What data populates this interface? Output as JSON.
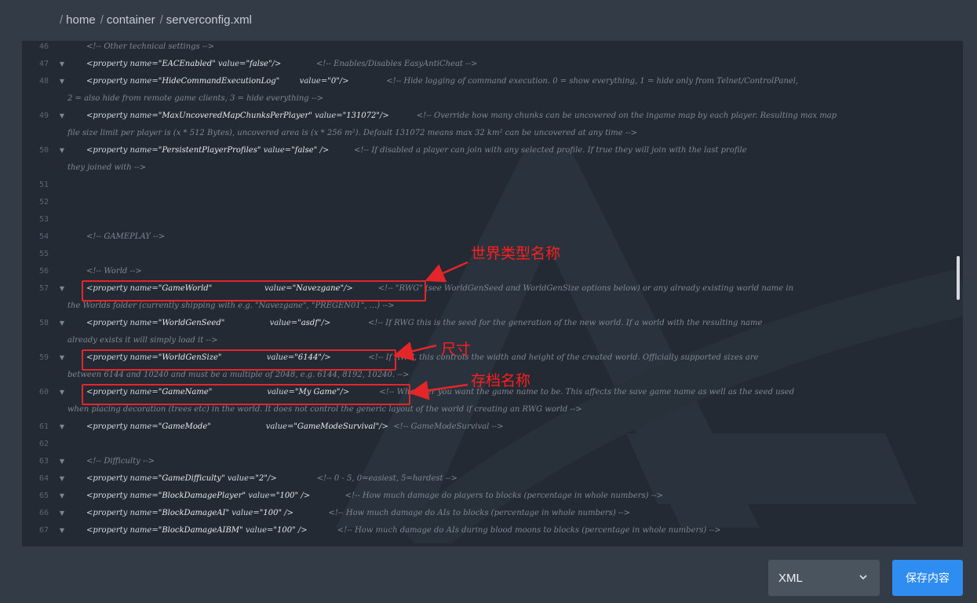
{
  "breadcrumb": {
    "items": [
      {
        "label": "home"
      },
      {
        "label": "container"
      },
      {
        "label": "serverconfig.xml"
      }
    ]
  },
  "editor": {
    "lines": [
      {
        "num": "46",
        "fold": false,
        "tokens": [
          [
            "tok-comment",
            "<!-- Other technical settings -->"
          ]
        ]
      },
      {
        "num": "47",
        "fold": true,
        "tokens": [
          [
            "tag",
            "<property "
          ],
          [
            "tok-attr",
            "name="
          ],
          [
            "tok-str",
            "\"EACEnabled\" "
          ],
          [
            "tok-attr",
            "value="
          ],
          [
            "tok-str",
            "\"false\""
          ],
          [
            "tag",
            "/>"
          ],
          [
            "tok-comment",
            "              <!-- Enables/Disables EasyAntiCheat -->"
          ]
        ]
      },
      {
        "num": "48",
        "fold": true,
        "tokens": [
          [
            "tag",
            "<property "
          ],
          [
            "tok-attr",
            "name="
          ],
          [
            "tok-str",
            "\"HideCommandExecutionLog\"        "
          ],
          [
            "tok-attr",
            "value="
          ],
          [
            "tok-str",
            "\"0\""
          ],
          [
            "tag",
            "/>"
          ],
          [
            "tok-comment",
            "               <!-- Hide logging of command execution. 0 = show everything, 1 = hide only from Telnet/ControlPanel,"
          ]
        ]
      },
      {
        "num": "",
        "fold": false,
        "cont": true,
        "tokens": [
          [
            "tok-comment",
            "2 = also hide from remote game clients, 3 = hide everything -->"
          ]
        ]
      },
      {
        "num": "49",
        "fold": true,
        "tokens": [
          [
            "tag",
            "<property "
          ],
          [
            "tok-attr",
            "name="
          ],
          [
            "tok-str",
            "\"MaxUncoveredMapChunksPerPlayer\" "
          ],
          [
            "tok-attr",
            "value="
          ],
          [
            "tok-str",
            "\"131072\""
          ],
          [
            "tag",
            "/>"
          ],
          [
            "tok-comment",
            "           <!-- Override how many chunks can be uncovered on the ingame map by each player. Resulting max map"
          ]
        ]
      },
      {
        "num": "",
        "fold": false,
        "cont": true,
        "tokens": [
          [
            "tok-comment",
            "file size limit per player is (x * 512 Bytes), uncovered area is (x * 256 m²). Default 131072 means max 32 km² can be uncovered at any time -->"
          ]
        ]
      },
      {
        "num": "50",
        "fold": true,
        "tokens": [
          [
            "tag",
            "<property "
          ],
          [
            "tok-attr",
            "name="
          ],
          [
            "tok-str",
            "\"PersistentPlayerProfiles\" "
          ],
          [
            "tok-attr",
            "value="
          ],
          [
            "tok-str",
            "\"false\" "
          ],
          [
            "tag",
            "/>"
          ],
          [
            "tok-comment",
            "          <!-- If disabled a player can join with any selected profile. If true they will join with the last profile"
          ]
        ]
      },
      {
        "num": "",
        "fold": false,
        "cont": true,
        "tokens": [
          [
            "tok-comment",
            "they joined with -->"
          ]
        ]
      },
      {
        "num": "51",
        "fold": false,
        "tokens": []
      },
      {
        "num": "52",
        "fold": false,
        "tokens": []
      },
      {
        "num": "53",
        "fold": false,
        "tokens": []
      },
      {
        "num": "54",
        "fold": false,
        "tokens": [
          [
            "tok-comment",
            "<!-- GAMEPLAY -->"
          ]
        ]
      },
      {
        "num": "55",
        "fold": false,
        "tokens": []
      },
      {
        "num": "56",
        "fold": false,
        "tokens": [
          [
            "tok-comment",
            "<!-- World -->"
          ]
        ]
      },
      {
        "num": "57",
        "fold": true,
        "tokens": [
          [
            "tag",
            "<property "
          ],
          [
            "tok-attr",
            "name="
          ],
          [
            "tok-str",
            "\"GameWorld\"                     "
          ],
          [
            "tok-attr",
            "value="
          ],
          [
            "tok-str",
            "\"Navezgane\""
          ],
          [
            "tag",
            "/>"
          ],
          [
            "tok-comment",
            "          <!-- \"RWG\" (see WorldGenSeed and WorldGenSize options below) or any already existing world name in"
          ]
        ]
      },
      {
        "num": "",
        "fold": false,
        "cont": true,
        "tokens": [
          [
            "tok-comment",
            "the Worlds folder (currently shipping with e.g. \"Navezgane\", \"PREGEN01\", ...) -->"
          ]
        ]
      },
      {
        "num": "58",
        "fold": true,
        "tokens": [
          [
            "tag",
            "<property "
          ],
          [
            "tok-attr",
            "name="
          ],
          [
            "tok-str",
            "\"WorldGenSeed\"                  "
          ],
          [
            "tok-attr",
            "value="
          ],
          [
            "tok-str",
            "\"asdf\""
          ],
          [
            "tag",
            "/>"
          ],
          [
            "tok-comment",
            "               <!-- If RWG this is the seed for the generation of the new world. If a world with the resulting name"
          ]
        ]
      },
      {
        "num": "",
        "fold": false,
        "cont": true,
        "tokens": [
          [
            "tok-comment",
            "already exists it will simply load it -->"
          ]
        ]
      },
      {
        "num": "59",
        "fold": true,
        "tokens": [
          [
            "tag",
            "<property "
          ],
          [
            "tok-attr",
            "name="
          ],
          [
            "tok-str",
            "\"WorldGenSize\"                  "
          ],
          [
            "tok-attr",
            "value="
          ],
          [
            "tok-str",
            "\"6144\""
          ],
          [
            "tag",
            "/>"
          ],
          [
            "tok-comment",
            "               <!-- If RWG, this controls the width and height of the created world. Officially supported sizes are"
          ]
        ]
      },
      {
        "num": "",
        "fold": false,
        "cont": true,
        "tokens": [
          [
            "tok-comment",
            "between 6144 and 10240 and must be a multiple of 2048, e.g. 6144, 8192, 10240. -->"
          ]
        ]
      },
      {
        "num": "60",
        "fold": true,
        "tokens": [
          [
            "tag",
            "<property "
          ],
          [
            "tok-attr",
            "name="
          ],
          [
            "tok-str",
            "\"GameName\"                      "
          ],
          [
            "tok-attr",
            "value="
          ],
          [
            "tok-str",
            "\"My Game\""
          ],
          [
            "tag",
            "/>"
          ],
          [
            "tok-comment",
            "            <!-- Whatever you want the game name to be. This affects the save game name as well as the seed used"
          ]
        ]
      },
      {
        "num": "",
        "fold": false,
        "cont": true,
        "tokens": [
          [
            "tok-comment",
            "when placing decoration (trees etc) in the world. It does not control the generic layout of the world if creating an RWG world -->"
          ]
        ]
      },
      {
        "num": "61",
        "fold": true,
        "tokens": [
          [
            "tag",
            "<property "
          ],
          [
            "tok-attr",
            "name="
          ],
          [
            "tok-str",
            "\"GameMode\"                      "
          ],
          [
            "tok-attr",
            "value="
          ],
          [
            "tok-str",
            "\"GameModeSurvival\""
          ],
          [
            "tag",
            "/>"
          ],
          [
            "tok-comment",
            "  <!-- GameModeSurvival -->"
          ]
        ]
      },
      {
        "num": "62",
        "fold": false,
        "tokens": []
      },
      {
        "num": "63",
        "fold": true,
        "tokens": [
          [
            "tok-comment",
            "<!-- Difficulty -->"
          ]
        ]
      },
      {
        "num": "64",
        "fold": true,
        "tokens": [
          [
            "tag",
            "<property "
          ],
          [
            "tok-attr",
            "name="
          ],
          [
            "tok-str",
            "\"GameDifficulty\" "
          ],
          [
            "tok-attr",
            "value="
          ],
          [
            "tok-str",
            "\"2\""
          ],
          [
            "tag",
            "/>"
          ],
          [
            "tok-comment",
            "                <!-- 0 - 5, 0=easiest, 5=hardest -->"
          ]
        ]
      },
      {
        "num": "65",
        "fold": true,
        "tokens": [
          [
            "tag",
            "<property "
          ],
          [
            "tok-attr",
            "name="
          ],
          [
            "tok-str",
            "\"BlockDamagePlayer\" "
          ],
          [
            "tok-attr",
            "value="
          ],
          [
            "tok-str",
            "\"100\" "
          ],
          [
            "tag",
            "/>"
          ],
          [
            "tok-comment",
            "              <!-- How much damage do players to blocks (percentage in whole numbers) -->"
          ]
        ]
      },
      {
        "num": "66",
        "fold": true,
        "tokens": [
          [
            "tag",
            "<property "
          ],
          [
            "tok-attr",
            "name="
          ],
          [
            "tok-str",
            "\"BlockDamageAI\" "
          ],
          [
            "tok-attr",
            "value="
          ],
          [
            "tok-str",
            "\"100\" "
          ],
          [
            "tag",
            "/>"
          ],
          [
            "tok-comment",
            "              <!-- How much damage do AIs to blocks (percentage in whole numbers) -->"
          ]
        ]
      },
      {
        "num": "67",
        "fold": true,
        "tokens": [
          [
            "tag",
            "<property "
          ],
          [
            "tok-attr",
            "name="
          ],
          [
            "tok-str",
            "\"BlockDamageAIBM\" "
          ],
          [
            "tok-attr",
            "value="
          ],
          [
            "tok-str",
            "\"100\" "
          ],
          [
            "tag",
            "/>"
          ],
          [
            "tok-comment",
            "            <!-- How much damage do AIs during blood moons to blocks (percentage in whole numbers) -->"
          ]
        ]
      }
    ]
  },
  "annotations": {
    "world_type_name": "世界类型名称",
    "size": "尺寸",
    "save_name": "存档名称",
    "color": "#e4262a"
  },
  "footer": {
    "format_select": {
      "value": "XML",
      "icon": "chevron-down-icon"
    },
    "save_button": {
      "label": "保存内容",
      "color": "#2f8cf0"
    }
  }
}
